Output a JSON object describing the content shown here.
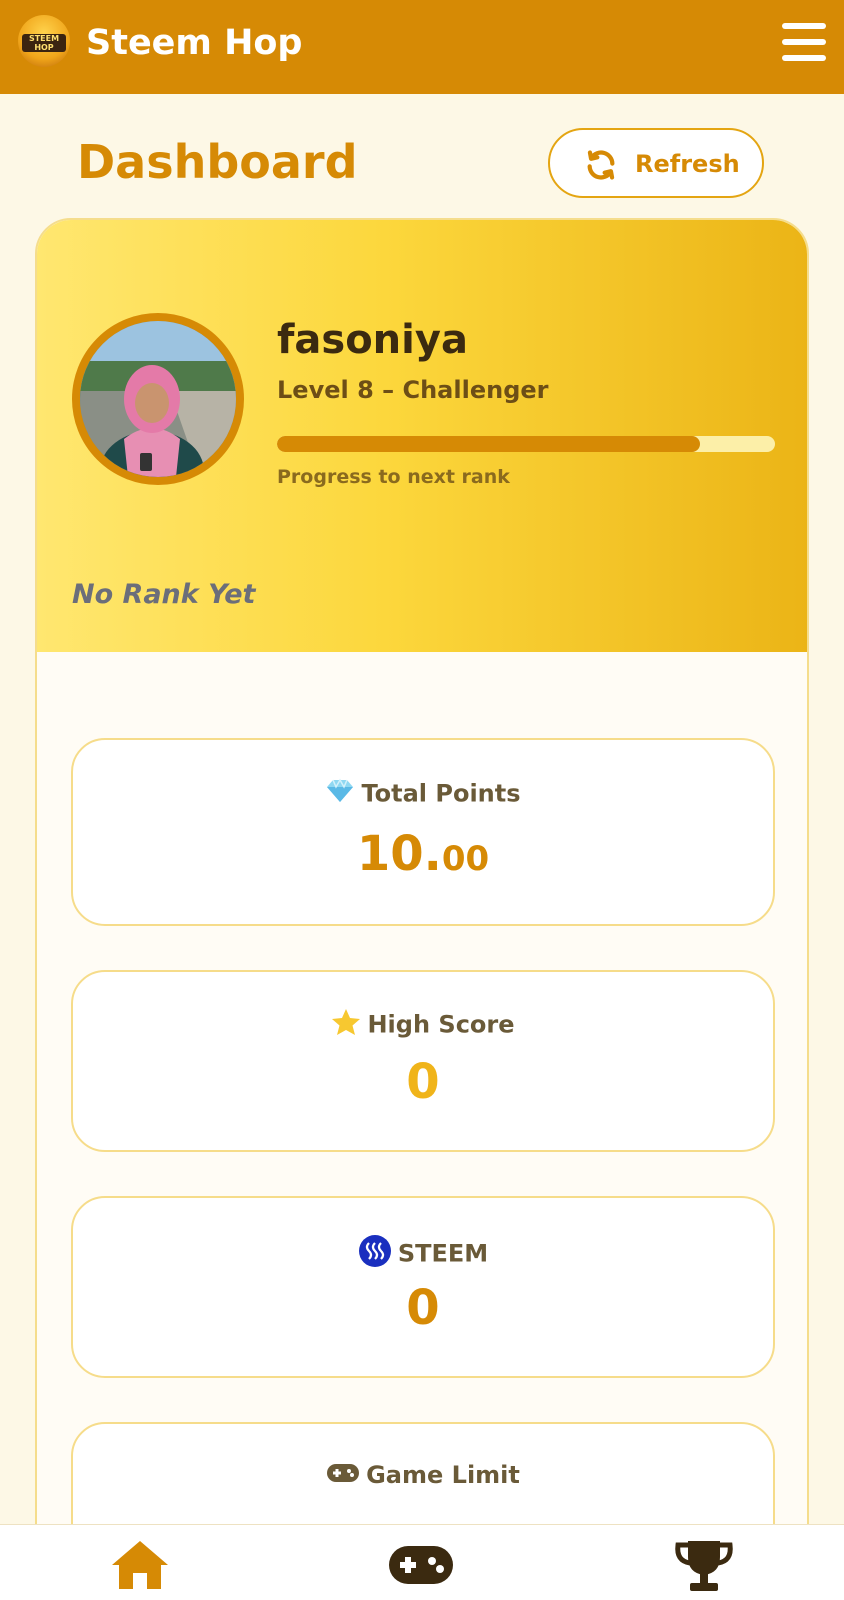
{
  "header": {
    "logo_text": "STEEM HOP",
    "app_title": "Steem Hop",
    "menu_icon": "hamburger-icon"
  },
  "page": {
    "title": "Dashboard",
    "refresh_label": "Refresh",
    "refresh_icon": "refresh-icon"
  },
  "profile": {
    "username": "fasoniya",
    "level_text": "Level 8 – Challenger",
    "progress_fraction": 0.85,
    "progress_label": "Progress to next rank",
    "rank_text": "No Rank Yet"
  },
  "stats": [
    {
      "icon": "gem-icon",
      "label": "Total Points",
      "value_main": "10.",
      "value_decimal": "00",
      "color": "#d68a05"
    },
    {
      "icon": "star-icon",
      "label": "High Score",
      "value_main": "0",
      "color": "#f0b41a"
    },
    {
      "icon": "steem-icon",
      "label": "STEEM",
      "value_main": "0",
      "color": "#d68a05"
    },
    {
      "icon": "gamepad-icon",
      "label": "Game Limit",
      "value_main": "",
      "color": "#d68a05"
    }
  ],
  "nav": {
    "items": [
      {
        "icon": "home-icon"
      },
      {
        "icon": "gamepad-icon"
      },
      {
        "icon": "trophy-icon"
      }
    ]
  },
  "colors": {
    "primary": "#d68a05",
    "accent": "#f0b41a",
    "background": "#fdf8e6"
  }
}
